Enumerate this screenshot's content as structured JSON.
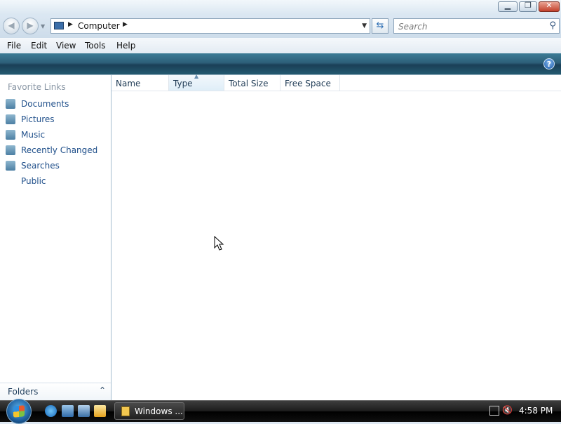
{
  "window": {
    "minimize_label": "▁",
    "maximize_label": "❐",
    "close_label": "✕"
  },
  "address": {
    "breadcrumb": "Computer",
    "search_placeholder": "Search"
  },
  "menu": [
    "File",
    "Edit",
    "View",
    "Tools",
    "Help"
  ],
  "commandbar": {
    "help_label": "?"
  },
  "nav": {
    "favorites_title": "Favorite Links",
    "items": [
      {
        "label": "Documents",
        "icon": "documents-icon"
      },
      {
        "label": "Pictures",
        "icon": "pictures-icon"
      },
      {
        "label": "Music",
        "icon": "music-icon"
      },
      {
        "label": "Recently Changed",
        "icon": "recently-changed-icon"
      },
      {
        "label": "Searches",
        "icon": "searches-icon"
      },
      {
        "label": "Public",
        "icon": "public-icon"
      }
    ],
    "folders_label": "Folders"
  },
  "columns": [
    {
      "label": "Name",
      "sorted": false
    },
    {
      "label": "Type",
      "sorted": true
    },
    {
      "label": "Total Size",
      "sorted": false
    },
    {
      "label": "Free Space",
      "sorted": false
    }
  ],
  "taskbar": {
    "task_label": "Windows ...",
    "clock": "4:58 PM"
  },
  "colors": {
    "accent": "#2d5f79",
    "link": "#1f4f8a"
  }
}
